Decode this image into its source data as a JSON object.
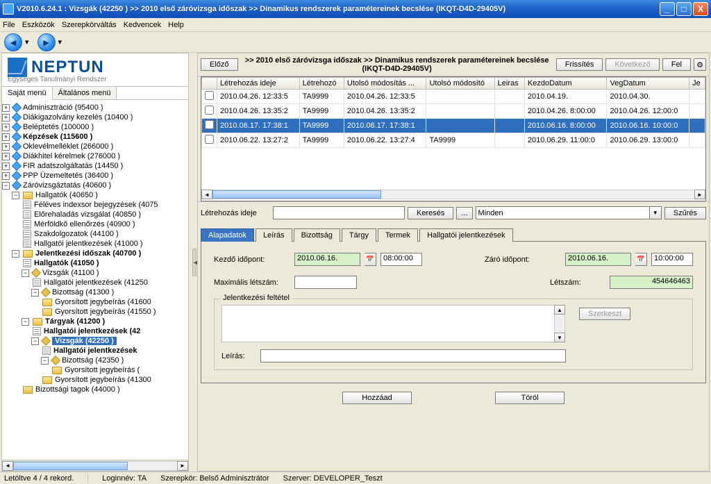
{
  "window": {
    "title": "V2010.6.24.1 : Vizsgák (42250  )   >> 2010 első záróvizsga időszak >> Dinamikus rendszerek paramétereinek becslése (IKQT-D4D-29405V)"
  },
  "menu": {
    "file": "File",
    "eszkozok": "Eszközök",
    "szerepkor": "Szerepkörváltás",
    "kedvencek": "Kedvencek",
    "help": "Help"
  },
  "logo": {
    "word": "NEPTUN",
    "tag": "Egységes Tanulmányi Rendszer"
  },
  "sidetabs": {
    "sajat": "Saját menü",
    "altalanos": "Általános menü"
  },
  "tree": {
    "n0": "Adminisztráció (95400  )",
    "n1": "Diákigazolvány kezelés (10400  )",
    "n2": "Beléptetés (100000  )",
    "n3": "Képzések (115600  )",
    "n4": "Oklevélmelléklet (266000  )",
    "n5": "Diákhitel kérelmek (276000  )",
    "n6": "FIR adatszolgáltatás (14450  )",
    "n7": "PPP Üzemeltetés (36400  )",
    "n8": "Záróvizsgáztatás (40600  )",
    "n8a": "Hallgatók (40650  )",
    "n8a1": "Féléves indexsor bejegyzések (4075",
    "n8a2": "Előrehaladás vizsgálat (40850  )",
    "n8a3": "Mérföldkő ellenőrzés (40900  )",
    "n8a4": "Szakdolgozatok (44100  )",
    "n8a5": "Hallgatói jelentkezések (41000  )",
    "n8b": "Jelentkezési időszak (40700  )",
    "n8b1": "Hallgatók (41050  )",
    "n8b2": "Vizsgák (41100  )",
    "n8b2a": "Hallgatói jelentkezések (41250",
    "n8b2b": "Bizottság (41300  )",
    "n8b2b1": "Gyorsított jegybeírás (41600",
    "n8b2b2": "Gyorsított jegybeírás (41550  )",
    "n8b3": "Tárgyak (41200  )",
    "n8b3a": "Hallgatói jelentkezések (42",
    "n8b3b": "Vizsgák (42250  )",
    "n8b3b1": "Hallgatói jelentkezések",
    "n8b3b2": "Bizottság (42350  )",
    "n8b3b2a": "Gyorsított jegybeírás (",
    "n8b3b3": "Gyorsított jegybeírás (41300",
    "n8b4": "Bizottsági tagok (44000  )"
  },
  "rhdr": {
    "prev": "Előző",
    "crumb": ">> 2010 első záróvizsga időszak >> Dinamikus rendszerek paramétereinek becslése (IKQT-D4D-29405V)",
    "refresh": "Frissítés",
    "next": "Következő",
    "up": "Fel"
  },
  "grid": {
    "headers": {
      "c0": "",
      "c1": "Létrehozás ideje",
      "c2": "Létrehozó",
      "c3": "Utolsó módosítás ...",
      "c4": "Utolsó módosító",
      "c5": "Leiras",
      "c6": "KezdoDatum",
      "c7": "VegDatum",
      "c8": "Je"
    },
    "rows": [
      {
        "c1": "2010.04.26. 12:33:5",
        "c2": "TA9999",
        "c3": "2010.04.26. 12:33:5",
        "c4": "",
        "c5": "",
        "c6": "2010.04.19.",
        "c7": "2010.04.30.",
        "c8": ""
      },
      {
        "c1": "2010.04.26. 13:35:2",
        "c2": "TA9999",
        "c3": "2010.04.26. 13:35:2",
        "c4": "",
        "c5": "",
        "c6": "2010.04.26. 8:00:00",
        "c7": "2010.04.26. 12:00:0",
        "c8": ""
      },
      {
        "c1": "2010.06.17. 17:38:1",
        "c2": "TA9999",
        "c3": "2010.06.17. 17:38:1",
        "c4": "",
        "c5": "",
        "c6": "2010.06.16. 8:00:00",
        "c7": "2010.06.16. 10:00:0",
        "c8": ""
      },
      {
        "c1": "2010.06.22. 13:27:2",
        "c2": "TA9999",
        "c3": "2010.06.22. 13:27:4",
        "c4": "TA9999",
        "c5": "",
        "c6": "2010.06.29. 11:00:0",
        "c7": "2010.06.29. 13:00:0",
        "c8": ""
      }
    ]
  },
  "search": {
    "label": "Létrehozás ideje",
    "keres": "Keresés",
    "dots": "...",
    "minden": "Minden",
    "szures": "Szűrés"
  },
  "dtabs": {
    "t0": "Alapadatok",
    "t1": "Leírás",
    "t2": "Bizottság",
    "t3": "Tárgy",
    "t4": "Termek",
    "t5": "Hallgatói jelentkezések"
  },
  "detail": {
    "kezdo_l": "Kezdő időpont:",
    "kezdo_d": "2010.06.16.",
    "kezdo_t": "08:00:00",
    "zaro_l": "Záró időpont:",
    "zaro_d": "2010.06.16.",
    "zaro_t": "10:00:00",
    "max_l": "Maximális létszám:",
    "max_v": "",
    "letszam_l": "Létszám:",
    "letszam_v": "454646463",
    "feltetel_l": "Jelentkezési feltétel",
    "feltetel_v": "",
    "szerk": "Szerkeszt",
    "leiras_l": "Leírás:",
    "leiras_v": "",
    "hozzaad": "Hozzáad",
    "torol": "Töröl"
  },
  "status": {
    "rec": "Letöltve 4 / 4 rekord.",
    "login": "Loginnév: TA",
    "szerep": "Szerepkör: Belső Adminisztrátor",
    "szerver": "Szerver: DEVELOPER_Teszt"
  }
}
